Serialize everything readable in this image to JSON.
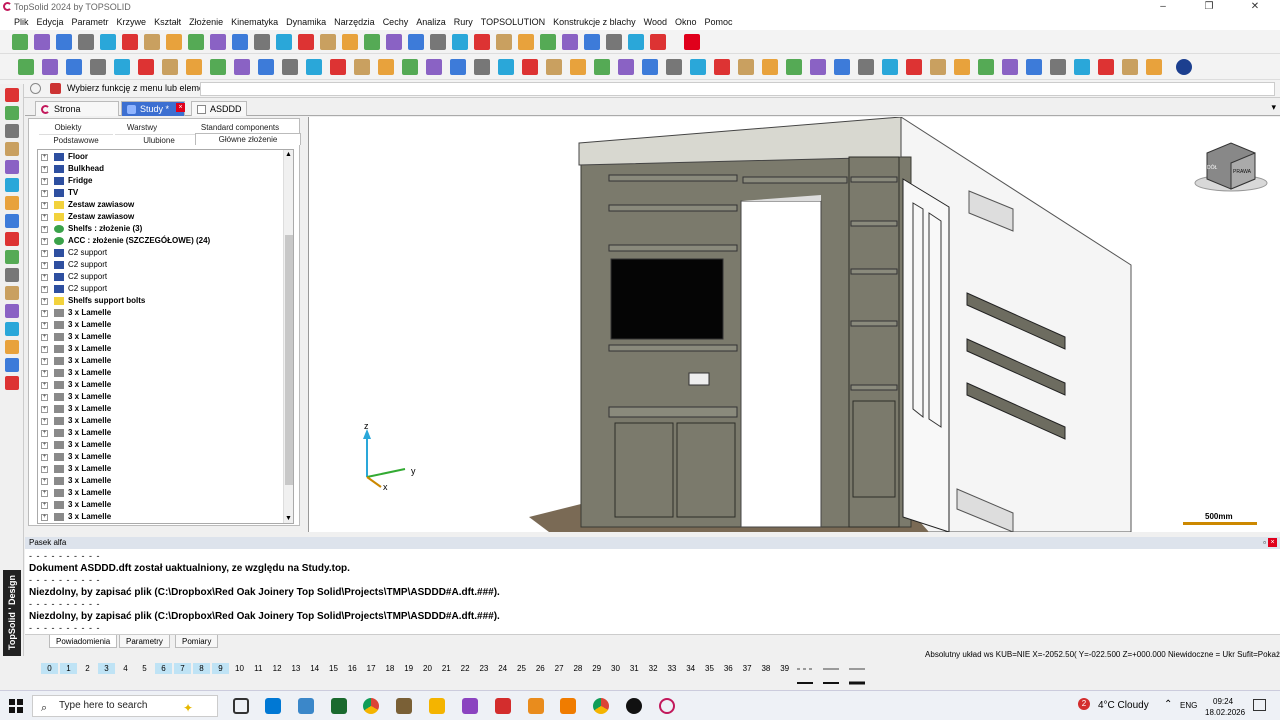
{
  "window": {
    "title": "TopSolid 2024 by TOPSOLID"
  },
  "menu": [
    "Plik",
    "Edycja",
    "Parametr",
    "Krzywe",
    "Kształt",
    "Złożenie",
    "Kinematyka",
    "Dynamika",
    "Narzędzia",
    "Cechy",
    "Analiza",
    "Rury",
    "TOPSOLUTION",
    "Konstrukcje z blachy",
    "Wood",
    "Okno",
    "Pomoc"
  ],
  "command": {
    "label": "Wybierz funkcję z menu lub element:",
    "value": ""
  },
  "doc_tabs": [
    {
      "label": "Strona startowa"
    },
    {
      "label": "Study *"
    },
    {
      "label": "ASDDD *"
    }
  ],
  "panel_tabs": {
    "row1": [
      "Obiekty",
      "Warstwy",
      "Standard components"
    ],
    "row2": [
      "Podstawowe",
      "Ulubione",
      "Główne złożenie"
    ]
  },
  "tree": [
    {
      "label": "Floor",
      "icon": "part-icon",
      "bold": true
    },
    {
      "label": "Bulkhead",
      "icon": "part-icon",
      "bold": true
    },
    {
      "label": "Fridge",
      "icon": "part-icon",
      "bold": true
    },
    {
      "label": "TV",
      "icon": "part-icon",
      "bold": true
    },
    {
      "label": "Zestaw zawiasow",
      "icon": "folder-icon",
      "bold": true
    },
    {
      "label": "Zestaw zawiasow",
      "icon": "folder-icon",
      "bold": true
    },
    {
      "label": "Shelfs : złożenie (3)",
      "icon": "assembly-icon",
      "bold": true
    },
    {
      "label": "ACC : złożenie (SZCZEGÓŁOWE) (24)",
      "icon": "assembly-icon",
      "bold": true
    },
    {
      "label": "C2 support",
      "icon": "part-icon",
      "bold": false
    },
    {
      "label": "C2 support",
      "icon": "part-icon",
      "bold": false
    },
    {
      "label": "C2 support",
      "icon": "part-icon",
      "bold": false
    },
    {
      "label": "C2 support",
      "icon": "part-icon",
      "bold": false
    },
    {
      "label": "Shelfs support bolts",
      "icon": "folder-icon",
      "bold": true
    },
    {
      "label": "3 x Lamelle",
      "icon": "lamelle-icon",
      "bold": true
    },
    {
      "label": "3 x Lamelle",
      "icon": "lamelle-icon",
      "bold": true
    },
    {
      "label": "3 x Lamelle",
      "icon": "lamelle-icon",
      "bold": true
    },
    {
      "label": "3 x Lamelle",
      "icon": "lamelle-icon",
      "bold": true
    },
    {
      "label": "3 x Lamelle",
      "icon": "lamelle-icon",
      "bold": true
    },
    {
      "label": "3 x Lamelle",
      "icon": "lamelle-icon",
      "bold": true
    },
    {
      "label": "3 x Lamelle",
      "icon": "lamelle-icon",
      "bold": true
    },
    {
      "label": "3 x Lamelle",
      "icon": "lamelle-icon",
      "bold": true
    },
    {
      "label": "3 x Lamelle",
      "icon": "lamelle-icon",
      "bold": true
    },
    {
      "label": "3 x Lamelle",
      "icon": "lamelle-icon",
      "bold": true
    },
    {
      "label": "3 x Lamelle",
      "icon": "lamelle-icon",
      "bold": true
    },
    {
      "label": "3 x Lamelle",
      "icon": "lamelle-icon",
      "bold": true
    },
    {
      "label": "3 x Lamelle",
      "icon": "lamelle-icon",
      "bold": true
    },
    {
      "label": "3 x Lamelle",
      "icon": "lamelle-icon",
      "bold": true
    },
    {
      "label": "3 x Lamelle",
      "icon": "lamelle-icon",
      "bold": true
    },
    {
      "label": "3 x Lamelle",
      "icon": "lamelle-icon",
      "bold": true
    },
    {
      "label": "3 x Lamelle",
      "icon": "lamelle-icon",
      "bold": true
    },
    {
      "label": "3 x Lamelle",
      "icon": "lamelle-icon",
      "bold": true
    },
    {
      "label": "3 x Lamelle",
      "icon": "lamelle-icon",
      "bold": true
    }
  ],
  "viewport": {
    "axis_labels": {
      "z": "z",
      "y": "y",
      "x": "x"
    },
    "view_cube": {
      "front": "DÓŁ",
      "right": "PRAWA"
    },
    "scale_label": "500mm"
  },
  "alpha": {
    "title": "Pasek alfa",
    "separator": "- - - - - - - - - -",
    "messages": [
      "Dokument ASDDD.dft został uaktualniony, ze względu na Study.top.",
      "Niezdolny, by zapisać plik (C:\\Dropbox\\Red Oak Joinery Top Solid\\Projects\\TMP\\ASDDD#A.dft.###).",
      "Niezdolny, by zapisać plik (C:\\Dropbox\\Red Oak Joinery Top Solid\\Projects\\TMP\\ASDDD#A.dft.###)."
    ],
    "tabs": [
      "Powiadomienia",
      "Parametry",
      "Pomiary"
    ]
  },
  "status": "Absolutny układ ws KUB=NIE  X=-2052.50(  Y=-022.500   Z=+000.000  Niewidoczne = Ukr  Sufit=Pokaż",
  "layers": {
    "numbers": [
      0,
      1,
      2,
      3,
      4,
      5,
      6,
      7,
      8,
      9,
      10,
      11,
      12,
      13,
      14,
      15,
      16,
      17,
      18,
      19,
      20,
      21,
      22,
      23,
      24,
      25,
      26,
      27,
      28,
      29,
      30,
      31,
      32,
      33,
      34,
      35,
      36,
      37,
      38,
      39
    ],
    "active": [
      0,
      1,
      3,
      6,
      7,
      8,
      9
    ]
  },
  "brand": "TopSolid ' Design",
  "taskbar": {
    "search_placeholder": "Type here to search",
    "weather": "4°C  Cloudy",
    "weather_badge": "2",
    "lang": "ENG",
    "time": "09:24",
    "date": "18.02.2026"
  },
  "colors": {
    "accent_red": "#e0001b",
    "cabinet": "#7b7a6c",
    "selected_layer": "#bfe3f5"
  }
}
